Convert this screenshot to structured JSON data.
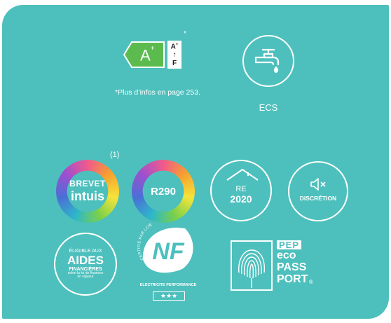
{
  "colors": {
    "panel_bg": "#4dc0bd",
    "energy_arrow": "#5cbb4e",
    "white": "#ffffff"
  },
  "energy_label": {
    "class": "A",
    "class_sup": "+",
    "scale_top": "A",
    "scale_top_sup": "+",
    "scale_arrow": "↑",
    "scale_bottom": "F",
    "asterisk": "*",
    "footnote": "*Plus d’infos en page 253."
  },
  "ecs": {
    "icon": "faucet-water-drop-icon",
    "label": "ECS"
  },
  "badges": {
    "brevet": {
      "footnote": "(1)",
      "line1": "BREVET",
      "line2": "intuis"
    },
    "r290": {
      "label": "R290"
    },
    "re2020": {
      "icon": "house-roof-icon",
      "line1": "RE",
      "line2": "2020"
    },
    "discretion": {
      "icon": "muted-speaker-icon",
      "label": "DISCRÉTION"
    },
    "aides": {
      "line1": "ÉLIGIBLE AUX",
      "line2": "AIDES",
      "line3": "FINANCIÈRES",
      "line4": "selon la loi de finances",
      "line5": "en vigueur"
    },
    "nf": {
      "arc_text": "CERTIFIÉ PAR LCIE",
      "logo": "NF",
      "caption": "ELECTRICITE PERFORMANCE",
      "stars": "★★★"
    },
    "pep": {
      "icon": "fingerprint-icon",
      "line1": "PEP",
      "line2": "eco",
      "line3": "PASS",
      "line4": "PORT",
      "mark": "®"
    }
  }
}
